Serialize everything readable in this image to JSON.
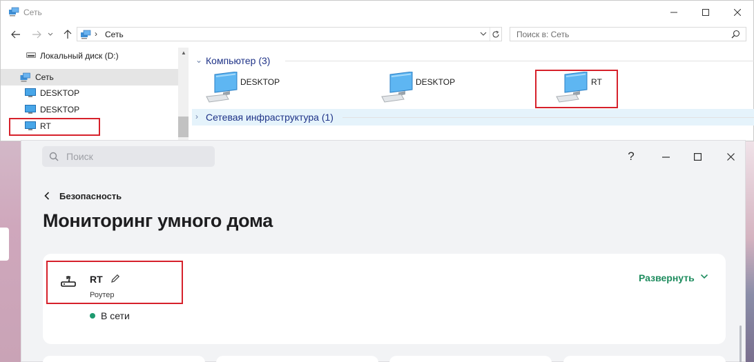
{
  "explorer": {
    "title": "Сеть",
    "address": {
      "separator": "›",
      "path": "Сеть"
    },
    "search_placeholder": "Поиск в: Сеть",
    "tree": [
      {
        "label": "Локальный диск (D:)",
        "icon": "drive-icon"
      },
      {
        "label": "Сеть",
        "icon": "network-icon",
        "selected": true
      },
      {
        "label": "DESKTOP",
        "icon": "computer-icon"
      },
      {
        "label": "DESKTOP",
        "icon": "computer-icon"
      },
      {
        "label": "RT",
        "icon": "computer-icon",
        "highlighted": true
      }
    ],
    "groups": {
      "computers": {
        "label": "Компьютер (3)",
        "chevron": "⌄"
      },
      "infrastructure": {
        "label": "Сетевая инфраструктура (1)",
        "chevron": "›"
      }
    },
    "computers": [
      {
        "label": "DESKTOP"
      },
      {
        "label": "DESKTOP"
      },
      {
        "label": "RT",
        "highlighted": true
      }
    ]
  },
  "app": {
    "search_placeholder": "Поиск",
    "help": "?",
    "breadcrumb": "Безопасность",
    "page_title": "Мониторинг умного дома",
    "device": {
      "name": "RT",
      "type": "Роутер",
      "status": "В сети",
      "status_color": "#1e9a6f",
      "expand_label": "Развернуть"
    }
  },
  "colors": {
    "highlight": "#d6202a",
    "accent_green": "#1e8c5e",
    "explorer_group": "#1e3287"
  }
}
